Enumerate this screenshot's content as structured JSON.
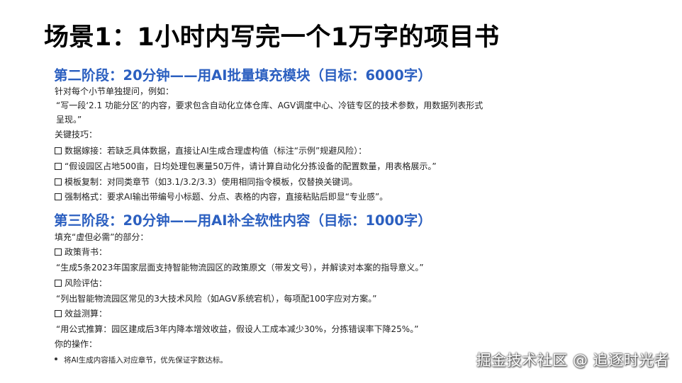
{
  "title": "场景1：1小时内写完一个1万字的项目书",
  "stage2": {
    "heading": "第二阶段：20分钟——用AI批量填充模块（目标：6000字）",
    "intro": "针对每个小节单独提问，例如：",
    "example_line1": "“写一段‘2.1 功能分区’的内容，要求包含自动化立体仓库、AGV调度中心、冷链专区的技术参数，用数据列表形式",
    "example_line2": "呈现。”",
    "tips_label": "关键技巧：",
    "tips": [
      "数据嫁接：若缺乏具体数据，直接让AI生成合理虚构值（标注“示例”规避风险）：",
      "“假设园区占地500亩，日均处理包裹量50万件，请计算自动化分拣设备的配置数量，用表格展示。”",
      "模板复制：对同类章节（如3.1/3.2/3.3）使用相同指令模板，仅替换关键词。",
      "强制格式：要求AI输出带编号小标题、分点、表格的内容，直接粘贴后即显“专业感”。"
    ]
  },
  "stage3": {
    "heading": "第三阶段：20分钟——用AI补全软性内容（目标：1000字）",
    "intro": "填充“虚但必需”的部分：",
    "items": [
      {
        "label": "政策背书：",
        "text": "“生成5条2023年国家层面支持智能物流园区的政策原文（带发文号），并解读对本案的指导意义。”"
      },
      {
        "label": "风险评估：",
        "text": "“列出智能物流园区常见的3大技术风险（如AGV系统宕机），每项配100字应对方案。”"
      },
      {
        "label": "效益测算：",
        "text": "“用公式推算：园区建成后3年内降本增效收益，假设人工成本减少30%，分拣错误率下降25%。”"
      }
    ],
    "your_ops_label": "你的操作：",
    "bullet": "将AI生成内容插入对应章节，优先保证字数达标。"
  },
  "watermark": "掘金技术社区 @ 追逐时光者"
}
